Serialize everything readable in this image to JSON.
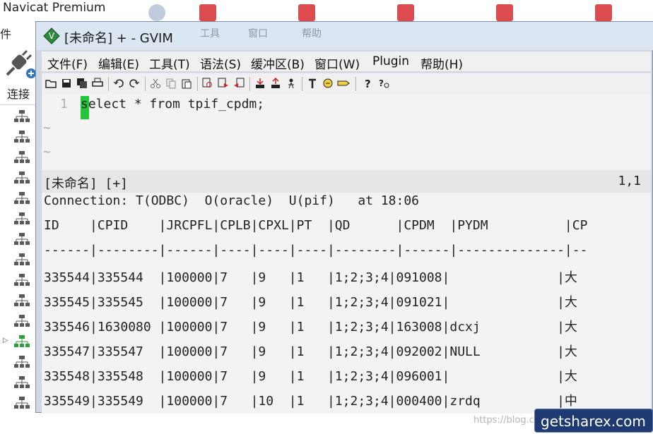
{
  "background_app": {
    "title": "Navicat Premium",
    "menu_fragment": "件",
    "connect_label": "连接",
    "tree_node_count": 15,
    "selected_node_index": 11
  },
  "gvim": {
    "title": "[未命名] + - GVIM",
    "ghost_menus": [
      "工具",
      "窗口",
      "帮助"
    ],
    "menu": [
      "文件(F)",
      "编辑(E)",
      "工具(T)",
      "语法(S)",
      "缓冲区(B)",
      "窗口(W)",
      "Plugin",
      "帮助(H)"
    ],
    "toolbar_icons": [
      "open-icon",
      "save-icon",
      "save-all-icon",
      "print-icon",
      "undo-icon",
      "redo-icon",
      "cut-icon",
      "copy-icon",
      "paste-icon",
      "find-replace-icon",
      "find-next-icon",
      "find-prev-icon",
      "load-session-icon",
      "save-session-icon",
      "run-script-icon",
      "make-icon",
      "run-ctags-icon",
      "tag-jump-icon",
      "help-icon",
      "find-help-icon"
    ],
    "editor": {
      "line_number": "1",
      "code": "select * from tpif_cpdm;",
      "empty_markers": [
        "~",
        "~"
      ]
    },
    "statusline": {
      "file": "[未命名] [+]",
      "position": "1,1"
    },
    "output": {
      "connection_line": "Connection: T(ODBC)  O(oracle)  U(pif)   at 18:06",
      "header": "ID    |CPID    |JRCPFL|CPLB|CPXL|PT  |QD      |CPDM  |PYDM          |CP",
      "separator": "------|--------|------|----|----|----|--------|------|--------------|--",
      "rows": [
        "335544|335544  |100000|7   |9   |1   |1;2;3;4|091008|              |大",
        "335545|335545  |100000|7   |9   |1   |1;2;3;4|091021|              |大",
        "335546|1630080 |100000|7   |9   |1   |1;2;3;4|163008|dcxj          |大",
        "335547|335547  |100000|7   |9   |1   |1;2;3;4|092002|NULL          |大",
        "335548|335548  |100000|7   |9   |1   |1;2;3;4|096001|              |大",
        "335549|335549  |100000|7   |10  |1   |1;2;3;4|000400|zrdq          |中"
      ]
    }
  },
  "watermarks": {
    "url": "https://blog.csdn.net/...",
    "badge": "getsharex.com"
  },
  "colors": {
    "cursor": "#22c43a",
    "titlebar": "#dce6f2",
    "editor_bg": "#f3f3f3",
    "tilde": "#9da8c0"
  }
}
